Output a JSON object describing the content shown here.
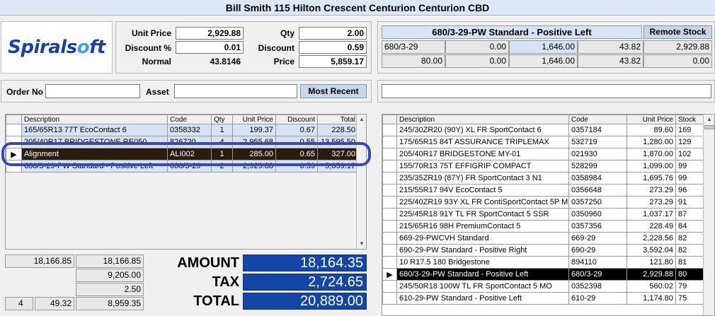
{
  "header": {
    "title": "Bill Smith  115 Hilton Crescent  Centurion  Centurion CBD"
  },
  "logo": {
    "text_a": "Spirals",
    "text_o": "o",
    "text_b": "ft"
  },
  "pricing": {
    "unit_price_label": "Unit Price",
    "unit_price": "2,929.88",
    "discount_pct_label": "Discount %",
    "discount_pct": "0.01",
    "normal_label": "Normal",
    "normal": "43.8146",
    "qty_label": "Qty",
    "qty": "2.00",
    "discount_label": "Discount",
    "discount": "0.59",
    "price_label": "Price",
    "price": "5,859.17"
  },
  "product_info": {
    "title": "680/3-29-PW Standard - Positive Left",
    "remote_stock_label": "Remote Stock",
    "row1": [
      "680/3-29",
      "0.00",
      "1,646.00",
      "43.82",
      "2,929.88"
    ],
    "row2": [
      "80.00",
      "0.00",
      "1,646.00",
      "43.82",
      "0.00"
    ]
  },
  "order": {
    "order_no_label": "Order No",
    "order_no": "",
    "asset_label": "Asset",
    "asset": "",
    "most_recent_label": "Most Recent",
    "search_value": ""
  },
  "order_table": {
    "headers": [
      "Description",
      "Code",
      "Qty",
      "Unit Price",
      "Discount",
      "Total"
    ],
    "rows": [
      [
        "165/65R13 77T EcoContact 6",
        "0358332",
        "1",
        "199.37",
        "0.67",
        "228.50"
      ],
      [
        "205/40R17 BRIDGESTONE RE050",
        "826720",
        "4",
        "2,955.68",
        "0.55",
        "13,595.50"
      ],
      [
        "Alignment",
        "ALI002",
        "1",
        "285.00",
        "0.65",
        "327.00"
      ],
      [
        "680/3-29-PW Standard - Positive Left",
        "680/3-29",
        "2",
        "2,929.88",
        "0.59",
        "5,859.17"
      ]
    ]
  },
  "stock_table": {
    "headers": [
      "Description",
      "Code",
      "Unit Price",
      "Stock"
    ],
    "rows": [
      [
        "245/30ZR20 (90Y) XL FR SportContact 6",
        "0357184",
        "89.60",
        "169"
      ],
      [
        "175/65R15 84T ASSURANCE TRIPLEMAX",
        "532719",
        "1,280.00",
        "129"
      ],
      [
        "205/40R17 BRIDGESTONE MY-01",
        "021930",
        "1,870.00",
        "102"
      ],
      [
        "155/70R13 75T EFFIGRIP COMPACT",
        "528299",
        "1,099.00",
        "99"
      ],
      [
        "235/35ZR19 (87Y) FR SportContact 3 N1",
        "0358984",
        "1,695.76",
        "99"
      ],
      [
        "215/55R17 94V EcoContact 5",
        "0356648",
        "273.29",
        "96"
      ],
      [
        "225/40ZR19 93Y XL FR ContiSportContact 5P MO",
        "0357250",
        "273.29",
        "91"
      ],
      [
        "225/45R18 91Y TL FR SportContact 5 SSR",
        "0350960",
        "1,037.17",
        "87"
      ],
      [
        "215/65R16 98H PremiumContact 5",
        "0357356",
        "228.49",
        "84"
      ],
      [
        "669-29-PWCVH Standard",
        "669-29",
        "2,228.56",
        "82"
      ],
      [
        "690-29-PW Standard - Positive Right",
        "690-29",
        "3,592.04",
        "82"
      ],
      [
        "10 R17.5 180 Bridgestone",
        "894110",
        "121.80",
        "81"
      ],
      [
        "680/3-29-PW Standard - Positive Left",
        "680/3-29",
        "2,929.88",
        "80"
      ],
      [
        "245/50R18 100W TL FR SportContact 5 MO",
        "0352398",
        "560.02",
        "79"
      ],
      [
        "610-29-PW Standard - Positive Left",
        "610-29",
        "1,174.80",
        "75"
      ]
    ]
  },
  "summary": {
    "a1": "18,166.85",
    "b1": "18,166.85",
    "b2": "9,205.00",
    "b3": "2.50",
    "count": "4",
    "c4": "49.32",
    "b4": "8,959.35",
    "amount_label": "AMOUNT",
    "amount": "18,164.35",
    "tax_label": "TAX",
    "tax": "2,724.65",
    "total_label": "TOTAL",
    "total": "20,889.00"
  }
}
